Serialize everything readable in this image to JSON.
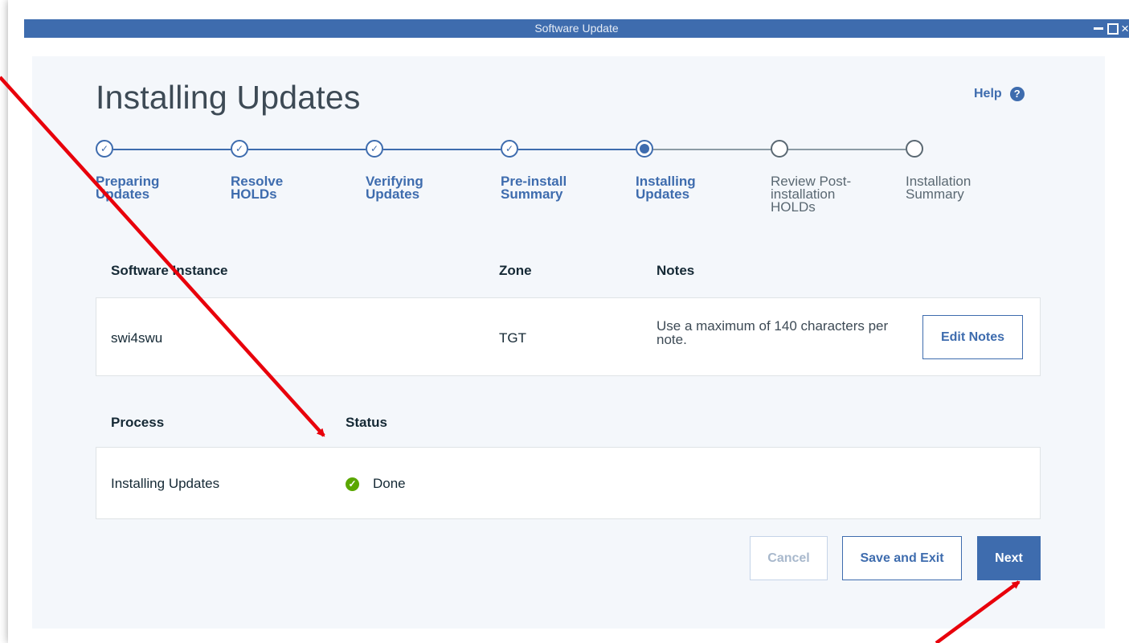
{
  "window": {
    "title": "Software Update",
    "controls": [
      "minimize",
      "maximize",
      "close"
    ]
  },
  "page": {
    "title": "Installing Updates",
    "help_label": "Help",
    "help_icon": "help-circle-icon"
  },
  "stepper": {
    "steps": [
      {
        "label": "Preparing Updates",
        "state": "done"
      },
      {
        "label": "Resolve HOLDs",
        "state": "done"
      },
      {
        "label": "Verifying Updates",
        "state": "done"
      },
      {
        "label": "Pre-install Summary",
        "state": "done"
      },
      {
        "label": "Installing Updates",
        "state": "current"
      },
      {
        "label": "Review Post-installation HOLDs",
        "state": "pending"
      },
      {
        "label": "Installation Summary",
        "state": "pending"
      }
    ]
  },
  "instance_table": {
    "headers": {
      "instance": "Software Instance",
      "zone": "Zone",
      "notes": "Notes"
    },
    "row": {
      "instance": "swi4swu",
      "zone": "TGT",
      "notes": "Use a maximum of 140 characters per note.",
      "edit_button": "Edit Notes"
    }
  },
  "process_table": {
    "headers": {
      "process": "Process",
      "status": "Status"
    },
    "row": {
      "process": "Installing Updates",
      "status": "Done",
      "status_icon": "check-circle-icon"
    }
  },
  "footer": {
    "cancel_label": "Cancel",
    "save_exit_label": "Save and Exit",
    "next_label": "Next"
  },
  "colors": {
    "titlebar": "#3e6cae",
    "accent": "#3e6cae",
    "success": "#5aa700",
    "annotation_arrow": "#e8000b",
    "content_bg": "#f4f7fb"
  }
}
